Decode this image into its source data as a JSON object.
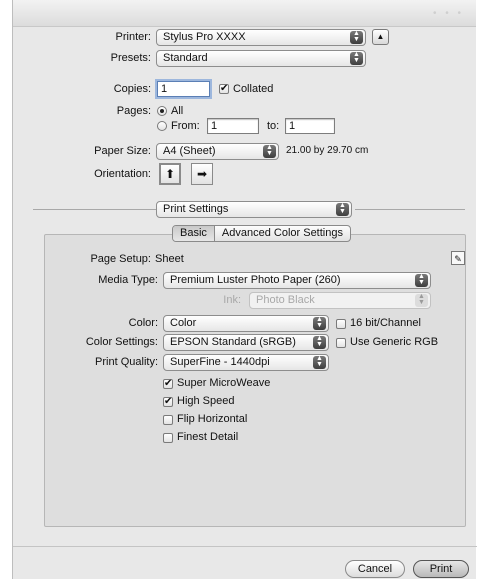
{
  "printer": {
    "label": "Printer:",
    "value": "Stylus Pro XXXX"
  },
  "presets": {
    "label": "Presets:",
    "value": "Standard"
  },
  "copies": {
    "label": "Copies:",
    "value": "1",
    "collated_label": "Collated",
    "collated": true
  },
  "pages": {
    "label": "Pages:",
    "all_label": "All",
    "from_label": "From:",
    "from_value": "1",
    "to_label": "to:",
    "to_value": "1",
    "selected": "All"
  },
  "paper_size": {
    "label": "Paper Size:",
    "value": "A4 (Sheet)",
    "dimensions": "21.00 by 29.70 cm"
  },
  "orientation": {
    "label": "Orientation:",
    "selected": "portrait"
  },
  "section_popup": {
    "value": "Print Settings"
  },
  "tabs": [
    {
      "label": "Basic",
      "selected": true
    },
    {
      "label": "Advanced Color Settings",
      "selected": false
    }
  ],
  "basic": {
    "page_setup": {
      "label": "Page Setup:",
      "value": "Sheet"
    },
    "media_type": {
      "label": "Media Type:",
      "value": "Premium Luster Photo Paper (260)"
    },
    "ink": {
      "label": "Ink:",
      "value": "Photo Black"
    },
    "color": {
      "label": "Color:",
      "value": "Color"
    },
    "bit16": {
      "label": "16 bit/Channel",
      "checked": false
    },
    "color_settings": {
      "label": "Color Settings:",
      "value": "EPSON Standard (sRGB)"
    },
    "generic_rgb": {
      "label": "Use Generic RGB",
      "checked": false
    },
    "print_quality": {
      "label": "Print Quality:",
      "value": "SuperFine - 1440dpi"
    },
    "options": [
      {
        "label": "Super MicroWeave",
        "checked": true
      },
      {
        "label": "High Speed",
        "checked": true
      },
      {
        "label": "Flip Horizontal",
        "checked": false
      },
      {
        "label": "Finest Detail",
        "checked": false
      }
    ]
  },
  "buttons": {
    "cancel": "Cancel",
    "print": "Print"
  },
  "icons": {
    "check": "✔",
    "arrows_up": "▲",
    "arrows_down": "▼",
    "disclosure": "▲"
  },
  "colors": {
    "dialog_bg": "#e8e8e8",
    "panel_bg": "#dedede"
  }
}
